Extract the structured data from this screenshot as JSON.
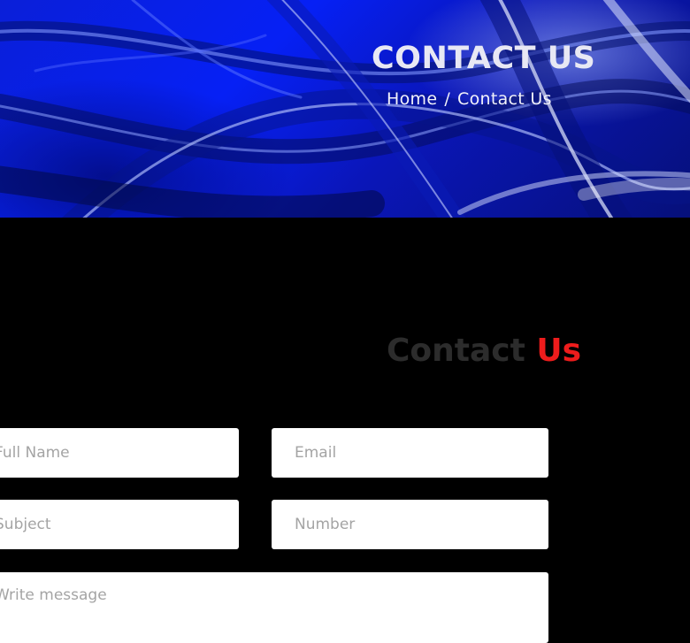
{
  "banner": {
    "title": "CONTACT US",
    "breadcrumb": {
      "home": "Home",
      "separator": "/",
      "current": "Contact Us"
    },
    "colors": {
      "primary": "#0620f5",
      "highlight": "#aabeff"
    }
  },
  "contact": {
    "heading_main": "Contact",
    "heading_accent": "Us",
    "colors": {
      "heading": "#2c2c2c",
      "accent": "#ee1c1c"
    }
  },
  "form": {
    "full_name_placeholder": "Full Name",
    "email_placeholder": "Email",
    "subject_placeholder": "Subject",
    "number_placeholder": "Number",
    "message_placeholder": "Write message"
  }
}
